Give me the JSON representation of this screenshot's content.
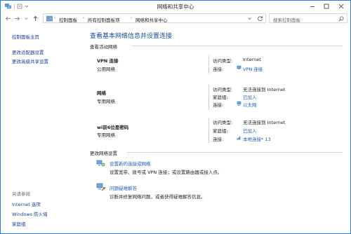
{
  "window": {
    "title": "网络和共享中心"
  },
  "address": {
    "crumbs": [
      "控制面板",
      "所有控制面板项",
      "网络和共享中心"
    ],
    "search_placeholder": "搜索控制面板"
  },
  "sidebar": {
    "links": [
      "控制面板主页",
      "更改适配器设置",
      "更改高级共享设置"
    ],
    "see_also_label": "另请参阅",
    "see_also": [
      "Internet 选项",
      "Windows 防火墙",
      "家庭组"
    ]
  },
  "main": {
    "title": "查看基本网络信息并设置连接",
    "active_networks_label": "查看活动网络",
    "networks": [
      {
        "name": "VPN 连接",
        "category": "公用网络",
        "props": [
          {
            "label": "访问类型:",
            "value": "Internet",
            "link": false
          },
          {
            "label": "连接:",
            "value": "VPN 连接",
            "link": true
          }
        ]
      },
      {
        "name": "网络",
        "category": "专用网络",
        "props": [
          {
            "label": "访问类型:",
            "value": "无法连接到 Internet",
            "link": false
          },
          {
            "label": "家庭组:",
            "value": "已加入",
            "link": true
          },
          {
            "label": "连接:",
            "value": "以太网",
            "link": true
          }
        ]
      },
      {
        "name": "wi前6位是密码",
        "category": "专用网络",
        "props": [
          {
            "label": "访问类型:",
            "value": "无法连接到 Internet",
            "link": false
          },
          {
            "label": "家庭组:",
            "value": "已加入",
            "link": true
          },
          {
            "label": "连接:",
            "value": "本地连接* 13",
            "link": true
          }
        ]
      }
    ],
    "change_settings_label": "更改网络设置",
    "tasks": [
      {
        "link": "设置新的连接或网络",
        "desc": "设置宽带、拨号或 VPN 连接；或设置路由器或接入点。"
      },
      {
        "link": "问题疑难解答",
        "desc": "诊断并修复网络问题，或者获得疑难解答信息。"
      }
    ]
  },
  "colors": {
    "link": "#1a5fb4",
    "title": "#1a4b96",
    "border": "#2b7bd1"
  }
}
